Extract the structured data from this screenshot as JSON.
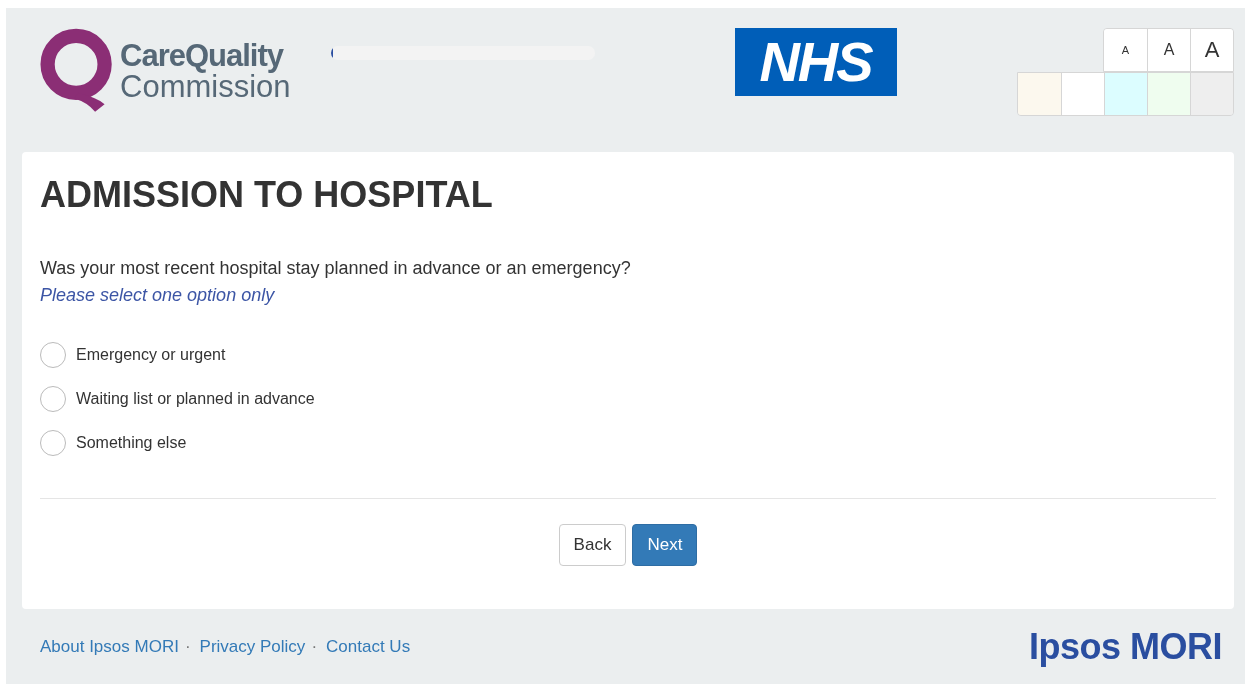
{
  "header": {
    "logo": {
      "line_1": "CareQuality",
      "line_2": "Commission"
    },
    "progress": {
      "level": 0.01
    },
    "nhs_logo": "NHS",
    "text_sizes": [
      {
        "label": "A",
        "selected": false
      },
      {
        "label": "A",
        "selected": false
      },
      {
        "label": "A",
        "selected": false
      }
    ],
    "themes": [
      {
        "color": "#fcf8ee"
      },
      {
        "color": "#ffffff"
      },
      {
        "color": "#dcfdff"
      },
      {
        "color": "#effdef"
      },
      {
        "color": "#eeeeee"
      }
    ]
  },
  "card": {
    "title": "ADMISSION TO HOSPITAL",
    "question": "Was your most recent hospital stay planned in advance or an emergency?",
    "instruction": "Please select one option only",
    "options": [
      {
        "label": "Emergency or urgent",
        "selected": false
      },
      {
        "label": "Waiting list or planned in advance",
        "selected": false
      },
      {
        "label": "Something else",
        "selected": false
      }
    ],
    "buttons": [
      {
        "label": "Back",
        "kind": "secondary"
      },
      {
        "label": "Next",
        "kind": "primary"
      }
    ]
  },
  "footer": {
    "links": [
      "About Ipsos MORI",
      "Privacy Policy",
      "Contact Us"
    ],
    "separator": "·",
    "brand": "Ipsos MORI"
  }
}
